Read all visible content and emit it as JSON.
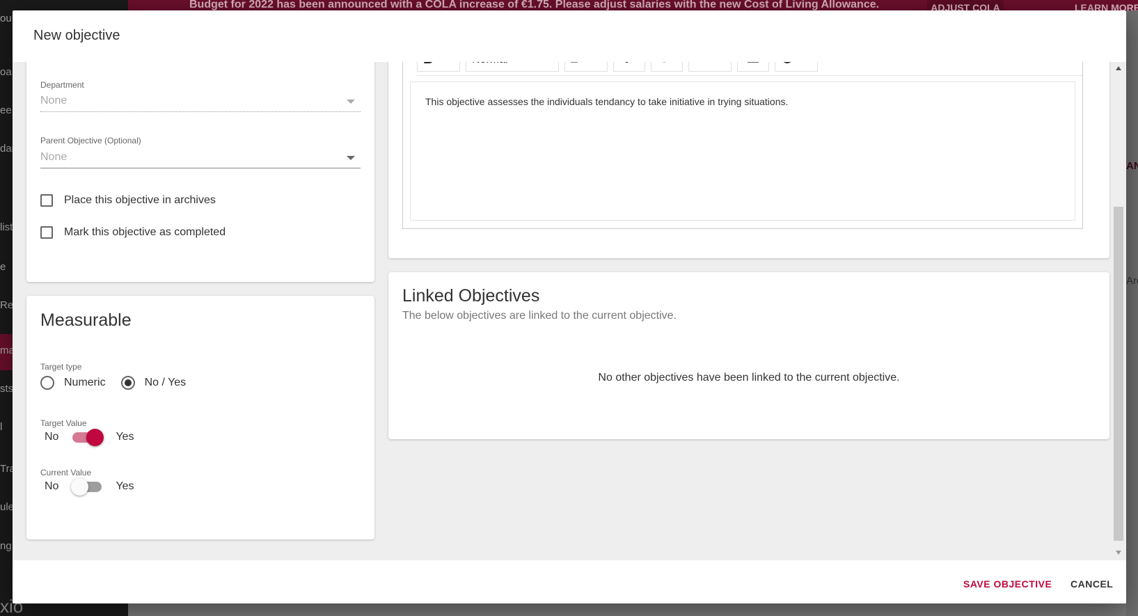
{
  "background": {
    "banner_text": "Budget for 2022 has been announced with a COLA increase of €1.75. Please adjust salaries with the new Cost of Living Allowance.",
    "banner_button": "ADJUST COLA",
    "banner_link": "LEARN MORE",
    "brand": "xio",
    "sidebar_fragments": [
      "ou",
      "oa",
      "ee",
      "dar",
      "list",
      "e",
      "Re",
      "ma",
      "sts",
      "l",
      "Tra",
      "ule",
      "ng"
    ],
    "right_fragments": [
      "AN",
      "Arc"
    ]
  },
  "modal": {
    "title": "New objective",
    "general": {
      "department_label": "Department",
      "department_value": "None",
      "parent_label": "Parent Objective (Optional)",
      "parent_value": "None",
      "archive_label": "Place this objective in archives",
      "completed_label": "Mark this objective as completed"
    },
    "editor": {
      "block_style": "Normal",
      "content": "This objective assesses the individuals tendancy to take initiative in trying situations."
    },
    "measurable": {
      "title": "Measurable",
      "target_type_label": "Target type",
      "options": [
        "Numeric",
        "No / Yes"
      ],
      "selected": "No / Yes",
      "target_value_label": "Target Value",
      "current_value_label": "Current Value",
      "no_label": "No",
      "yes_label": "Yes",
      "target_value_on": true,
      "current_value_on": false
    },
    "linked": {
      "title": "Linked Objectives",
      "subtitle": "The below objectives are linked to the current objective.",
      "empty": "No other objectives have been linked to the current objective."
    },
    "footer": {
      "save": "SAVE OBJECTIVE",
      "cancel": "CANCEL"
    }
  },
  "colors": {
    "accent": "#c1073f",
    "banner": "#6b0f2c"
  }
}
